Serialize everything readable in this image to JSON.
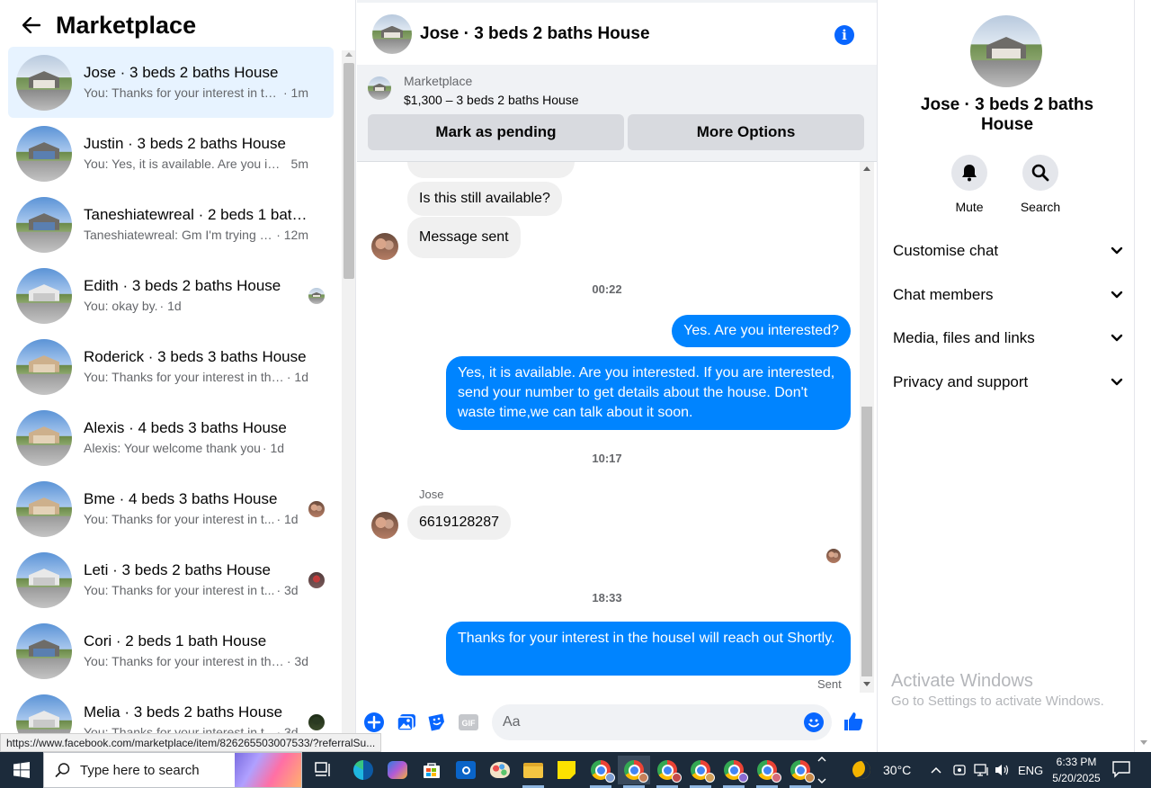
{
  "marketplace": {
    "title": "Marketplace",
    "conversations": [
      {
        "name": "Jose · 3 beds 2 baths House",
        "preview": "You: Thanks for your interest in th...",
        "time": "· 1m",
        "active": true
      },
      {
        "name": "Justin · 3 beds 2 baths House",
        "preview": "You: Yes, it is available. Are you int...",
        "time": "5m"
      },
      {
        "name": "Taneshiatewreal · 2 beds 1 bath ...",
        "preview": "Taneshiatewreal: Gm I'm trying to...",
        "time": "· 12m"
      },
      {
        "name": "Edith · 3 beds 2 baths House",
        "preview": "You: okay by.",
        "time": "· 1d"
      },
      {
        "name": "Roderick · 3 beds 3 baths House",
        "preview": "You: Thanks for your interest in the...",
        "time": "· 1d"
      },
      {
        "name": "Alexis · 4 beds 3 baths House",
        "preview": "Alexis: Your welcome thank you",
        "time": "· 1d"
      },
      {
        "name": "Bme · 4 beds 3 baths House",
        "preview": "You: Thanks for your interest in t...",
        "time": "· 1d"
      },
      {
        "name": "Leti · 3 beds 2 baths House",
        "preview": "You: Thanks for your interest in t...",
        "time": "· 3d"
      },
      {
        "name": "Cori · 2 beds 1 bath House",
        "preview": "You: Thanks for your interest in the...",
        "time": "· 3d"
      },
      {
        "name": "Melia · 3 beds 2 baths House",
        "preview": "You: Thanks for your interest in t...",
        "time": "· 3d"
      }
    ]
  },
  "chat": {
    "title": "Jose · 3 beds 2 baths House",
    "listing": {
      "label": "Marketplace",
      "price_title": "$1,300 – 3 beds 2 baths House",
      "pending_button": "Mark as pending",
      "more_button": "More Options"
    },
    "messages": {
      "still_available": "Is this still available?",
      "message_sent": "Message sent",
      "time1": "00:22",
      "out1": "Yes. Are you interested?",
      "out2": "Yes, it is available. Are you interested. If you are interested, send your number to get details about the house. Don't waste time,we can talk about it soon.",
      "time2": "10:17",
      "sender": "Jose",
      "phone": "6619128287",
      "time3": "18:33",
      "out3": "Thanks for your interest in the houseI will reach out Shortly.",
      "sent": "Sent"
    },
    "composer_placeholder": "Aa"
  },
  "details": {
    "name": "Jose · 3 beds 2 baths House",
    "mute_label": "Mute",
    "search_label": "Search",
    "sections": [
      "Customise chat",
      "Chat members",
      "Media, files and links",
      "Privacy and support"
    ]
  },
  "watermark": {
    "line1": "Activate Windows",
    "line2": "Go to Settings to activate Windows."
  },
  "status_url": "https://www.facebook.com/marketplace/item/826265503007533/?referralSu...",
  "taskbar": {
    "search_placeholder": "Type here to search",
    "weather": "30°C",
    "language": "ENG",
    "time": "6:33 PM",
    "date": "5/20/2025"
  },
  "colors": {
    "accent": "#0866ff",
    "outgoing_bubble": "#0084ff",
    "active_row": "#e7f3ff",
    "taskbar": "#1c2b3b"
  }
}
